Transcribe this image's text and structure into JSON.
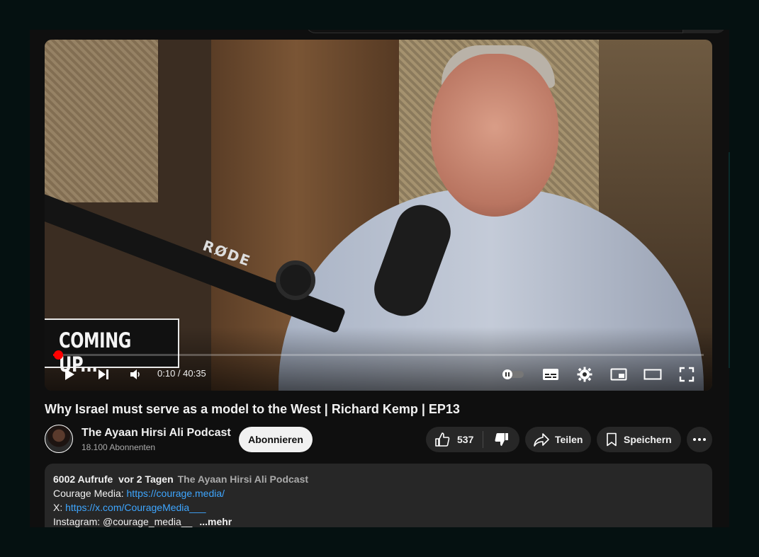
{
  "video": {
    "overlay_text": "COMING UP...",
    "mic_brand": "RØDE",
    "time_current": "0:10",
    "time_separator": " / ",
    "time_total": "40:35",
    "progress": 0.004
  },
  "title": "Why Israel must serve as a model to the West | Richard Kemp | EP13",
  "channel": {
    "name": "The Ayaan Hirsi Ali Podcast",
    "subscribers": "18.100 Abonnenten",
    "subscribe_label": "Abonnieren"
  },
  "actions": {
    "likes": "537",
    "share_label": "Teilen",
    "save_label": "Speichern"
  },
  "description": {
    "views": "6002 Aufrufe",
    "date": "vor 2 Tagen",
    "channel": "The Ayaan Hirsi Ali Podcast",
    "line1_label": "Courage Media: ",
    "line1_link": "https://courage.media/",
    "line2_label": "X: ",
    "line2_link": "https://x.com/CourageMedia___",
    "line3_text": "Instagram: @courage_media__",
    "more_label": "...mehr"
  },
  "colors": {
    "progress": "#ff0000",
    "link": "#3ea6ff",
    "background": "#0f0f0f"
  }
}
